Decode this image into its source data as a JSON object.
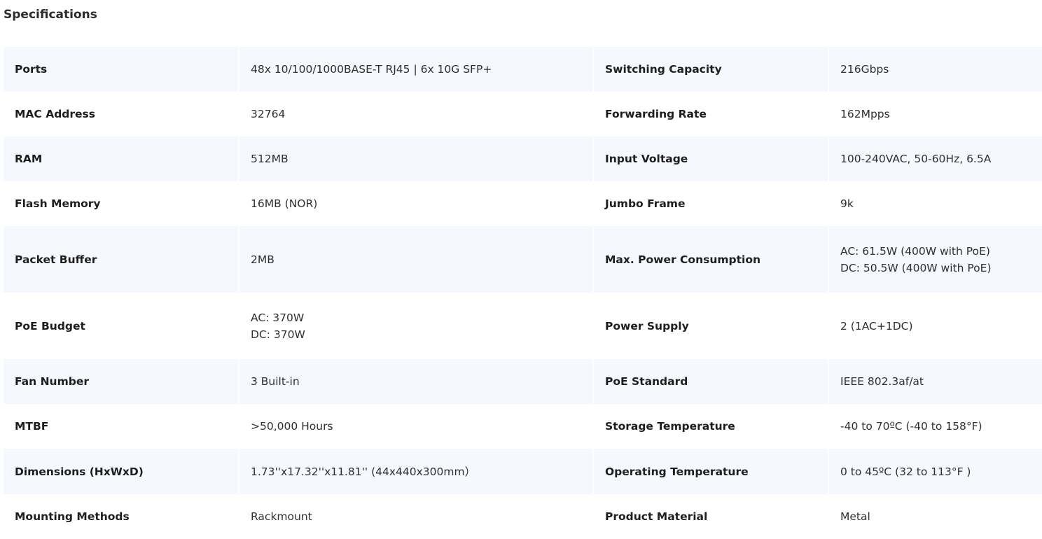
{
  "page": {
    "title": "Specifications"
  },
  "rows": [
    {
      "left_label": "Ports",
      "left_value": "48x 10/100/1000BASE-T RJ45 | 6x 10G SFP+",
      "right_label": "Switching Capacity",
      "right_value": "216Gbps"
    },
    {
      "left_label": "MAC Address",
      "left_value": "32764",
      "right_label": "Forwarding Rate",
      "right_value": "162Mpps"
    },
    {
      "left_label": "RAM",
      "left_value": "512MB",
      "right_label": "Input Voltage",
      "right_value": "100-240VAC, 50-60Hz, 6.5A"
    },
    {
      "left_label": "Flash Memory",
      "left_value": "16MB (NOR)",
      "right_label": "Jumbo Frame",
      "right_value": "9k"
    },
    {
      "left_label": "Packet Buffer",
      "left_value": "2MB",
      "right_label": "Max. Power Consumption",
      "right_value_lines": [
        "AC: 61.5W (400W with PoE)",
        "DC: 50.5W (400W with PoE)"
      ]
    },
    {
      "left_label": "PoE Budget",
      "left_value_lines": [
        "AC: 370W",
        "DC: 370W"
      ],
      "right_label": "Power Supply",
      "right_value": "2 (1AC+1DC)"
    },
    {
      "left_label": "Fan Number",
      "left_value": "3 Built-in",
      "right_label": "PoE Standard",
      "right_value": "IEEE 802.3af/at"
    },
    {
      "left_label": "MTBF",
      "left_value": ">50,000 Hours",
      "right_label": "Storage Temperature",
      "right_value": "-40 to 70ºC (-40 to 158°F)"
    },
    {
      "left_label": "Dimensions (HxWxD)",
      "left_value": "1.73''x17.32''x11.81'' (44x440x300mm）",
      "right_label": "Operating Temperature",
      "right_value": "0 to 45ºC (32 to 113°F )"
    },
    {
      "left_label": "Mounting Methods",
      "left_value": "Rackmount",
      "right_label": "Product Material",
      "right_value": "Metal"
    }
  ],
  "colors": {
    "row_shade": "#f5f8fe",
    "row_plain": "#ffffff",
    "label_text": "#1e1e1e",
    "value_text": "#2f2f2f"
  }
}
